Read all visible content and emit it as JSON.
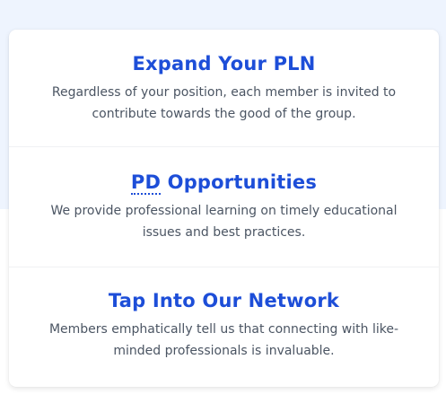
{
  "features": [
    {
      "title": "Expand Your PLN",
      "description": "Regardless of your position, each member is invited to contribute towards the good of the group."
    },
    {
      "title_abbr": "PD",
      "title_rest": " Opportunities",
      "description": "We provide professional learning on timely educational issues and best practices."
    },
    {
      "title": "Tap Into Our Network",
      "description": "Members emphatically tell us that connecting with like-minded professionals is invaluable."
    }
  ],
  "colors": {
    "heading": "#1d4ed8",
    "body_text": "#4b5563",
    "top_background": "#eef4fe"
  }
}
